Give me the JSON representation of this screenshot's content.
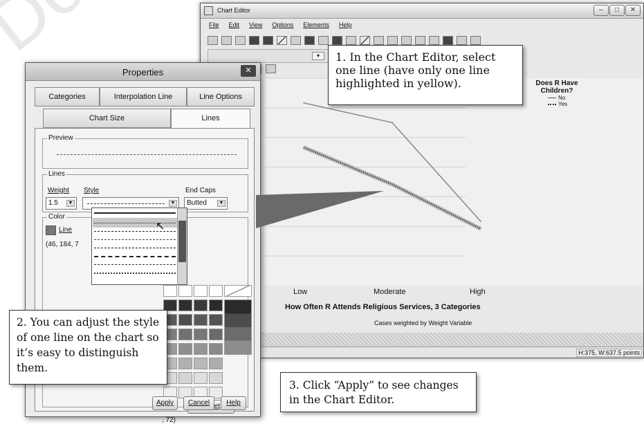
{
  "chart_editor": {
    "title": "Chart Editor",
    "menu": [
      "File",
      "Edit",
      "View",
      "Options",
      "Elements",
      "Help"
    ],
    "status": "H:375, W:637.5 points"
  },
  "chart_data": {
    "type": "line",
    "categories": [
      "Low",
      "Moderate",
      "High"
    ],
    "series": [
      {
        "name": "No",
        "values": [
          3.7,
          3.3,
          1.3
        ],
        "style": "solid"
      },
      {
        "name": "Yes",
        "values": [
          2.8,
          2.05,
          1.15
        ],
        "style": "dotted",
        "highlighted": true
      }
    ],
    "ylim": [
      0,
      4.2
    ],
    "xlabel": "How Often R Attends Religious Services, 3 Categories",
    "ylabel": "",
    "legend_title": "Does R Have Children?",
    "legend_position": "right",
    "footnote": "Cases weighted by Weight Variable",
    "grid": true
  },
  "properties": {
    "title": "Properties",
    "tabs_row1": [
      "Categories",
      "Interpolation Line",
      "Line Options"
    ],
    "tabs_row2": [
      "Chart Size",
      "Lines"
    ],
    "preview_label": "Preview",
    "lines_label": "Lines",
    "weight_label": "Weight",
    "weight_value": "1.5",
    "style_label": "Style",
    "endcaps_label": "End Caps",
    "endcaps_value": "Butted",
    "color_label": "Color",
    "line_label": "Line",
    "rgb_value": "(46, 184, 7",
    "rgb_tail": ", 72)",
    "reset_label": "Reset",
    "apply_label": "Apply",
    "cancel_label": "Cancel",
    "help_label": "Help"
  },
  "callouts": {
    "c1": "1. In the Chart Editor, select one line (have only one line highlighted in yellow).",
    "c2": "2. You can adjust the style of one line on the chart so it’s easy to distinguish them.",
    "c3": "3. Click “Apply” to see changes in the Chart Editor."
  },
  "watermark": "Do not copy, post"
}
